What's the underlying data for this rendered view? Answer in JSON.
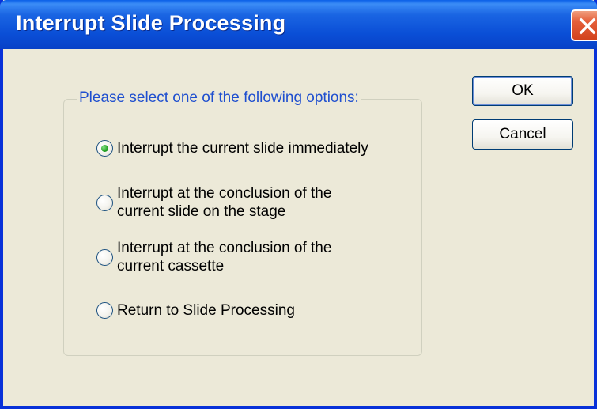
{
  "window": {
    "title": "Interrupt Slide Processing"
  },
  "titlebar": {
    "close_icon": "close-icon"
  },
  "options_group": {
    "legend": "Please select one of the following options:",
    "options": [
      {
        "label_lines": [
          "Interrupt the current slide immediately"
        ],
        "selected": true
      },
      {
        "label_lines": [
          "Interrupt at the conclusion of the",
          "current slide on the stage"
        ],
        "selected": false
      },
      {
        "label_lines": [
          "Interrupt at the conclusion of the",
          "current cassette"
        ],
        "selected": false
      },
      {
        "label_lines": [
          "Return to Slide Processing"
        ],
        "selected": false
      }
    ]
  },
  "buttons": {
    "ok_label": "OK",
    "cancel_label": "Cancel"
  },
  "colors": {
    "titlebar": "#0a4ed6",
    "window_bg": "#ece9d8",
    "legend_text": "#1f4fcf",
    "close_button": "#d2421c",
    "radio_selected_dot": "#21a121"
  }
}
